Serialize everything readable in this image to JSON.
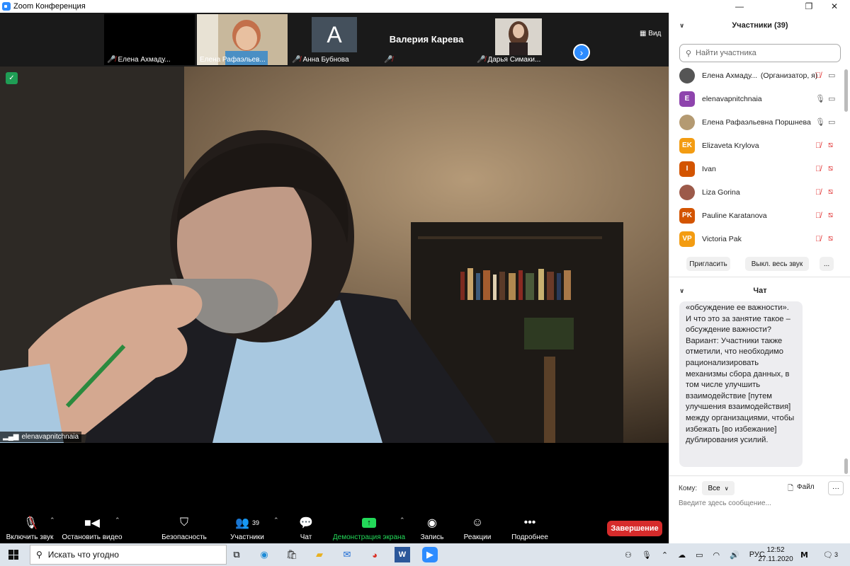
{
  "window": {
    "title": "Zoom Конференция",
    "minimize": "—",
    "restore": "❐",
    "close": "✕"
  },
  "thumbnails": [
    {
      "name": "Елена Ахмаду...",
      "muted": true,
      "type": "blank",
      "bg": "#000000"
    },
    {
      "name": "Елена Рафаэльев...",
      "muted": false,
      "type": "photo",
      "bg": "#b49a72"
    },
    {
      "name": "Анна Бубнова",
      "muted": true,
      "type": "letter",
      "letter": "A",
      "bg": "#44505c"
    },
    {
      "name": "",
      "muted": true,
      "type": "nameonly",
      "display": "Валерия Карева",
      "bg": "#1a1a1a"
    },
    {
      "name": "Дарья Симаки...",
      "muted": true,
      "type": "photo2",
      "bg": "#6b5a4e"
    }
  ],
  "view_label": "Вид",
  "main_video": {
    "speaker": "elenavapnitchnaia"
  },
  "toolbar": [
    {
      "label": "Включить звук",
      "icon": "mic-off-icon",
      "caret": true
    },
    {
      "label": "Остановить видео",
      "icon": "video-icon",
      "caret": true
    },
    {
      "label": "Безопасность",
      "icon": "shield-icon",
      "caret": false
    },
    {
      "label": "Участники",
      "icon": "participants-icon",
      "count": "39",
      "caret": true
    },
    {
      "label": "Чат",
      "icon": "chat-icon",
      "caret": false
    },
    {
      "label": "Демонстрация экрана",
      "icon": "share-screen-icon",
      "caret": true,
      "accent": "#23d959"
    },
    {
      "label": "Запись",
      "icon": "record-icon",
      "caret": false
    },
    {
      "label": "Реакции",
      "icon": "reactions-icon",
      "caret": false
    },
    {
      "label": "Подробнее",
      "icon": "more-icon",
      "caret": false
    }
  ],
  "end_button": "Завершение",
  "participants_panel": {
    "title": "Участники (39)",
    "search_placeholder": "Найти участника",
    "list": [
      {
        "name": "Елена Ахмаду...",
        "role": "(Организатор, я)",
        "avatar": "",
        "avatar_color": "#555555",
        "mic": "off",
        "video": "on"
      },
      {
        "name": "elenavapnitchnaia",
        "role": "",
        "avatar": "E",
        "avatar_color": "#8e44ad",
        "mic": "on",
        "video": "on"
      },
      {
        "name": "Елена Рафаэльевна Поршнева",
        "role": "",
        "avatar": "",
        "avatar_color": "#b49a72",
        "mic": "on",
        "video": "on"
      },
      {
        "name": "Elizaveta Krylova",
        "role": "",
        "avatar": "EK",
        "avatar_color": "#f39c12",
        "mic": "off",
        "video": "off"
      },
      {
        "name": "Ivan",
        "role": "",
        "avatar": "I",
        "avatar_color": "#d35400",
        "mic": "off",
        "video": "off"
      },
      {
        "name": "Liza Gorina",
        "role": "",
        "avatar": "",
        "avatar_color": "#9c5a4a",
        "mic": "off",
        "video": "off"
      },
      {
        "name": "Pauline Karatanova",
        "role": "",
        "avatar": "PK",
        "avatar_color": "#d35400",
        "mic": "off",
        "video": "off"
      },
      {
        "name": "Victoria Pak",
        "role": "",
        "avatar": "VP",
        "avatar_color": "#f39c12",
        "mic": "off",
        "video": "off"
      }
    ],
    "buttons": {
      "invite": "Пригласить",
      "mute_all": "Выкл. весь звук",
      "more": "..."
    }
  },
  "chat_panel": {
    "title": "Чат",
    "message": "«обсуждение ее важности». И что это за занятие такое – обсуждение важности? Вариант: Участники также отметили, что необходимо рационализировать механизмы сбора данных, в том числе улучшить взаимодействие [путем улучшения взаимодействия] между организациями, чтобы избежать [во избежание] дублирования усилий.",
    "to_label": "Кому:",
    "to_value": "Все",
    "file_label": "Файл",
    "more": "···",
    "input_placeholder": "Введите здесь сообщение..."
  },
  "taskbar": {
    "search_placeholder": "Искать что угодно",
    "lang": "РУС",
    "time": "12:52",
    "date": "27.11.2020",
    "notif_count": "3"
  }
}
